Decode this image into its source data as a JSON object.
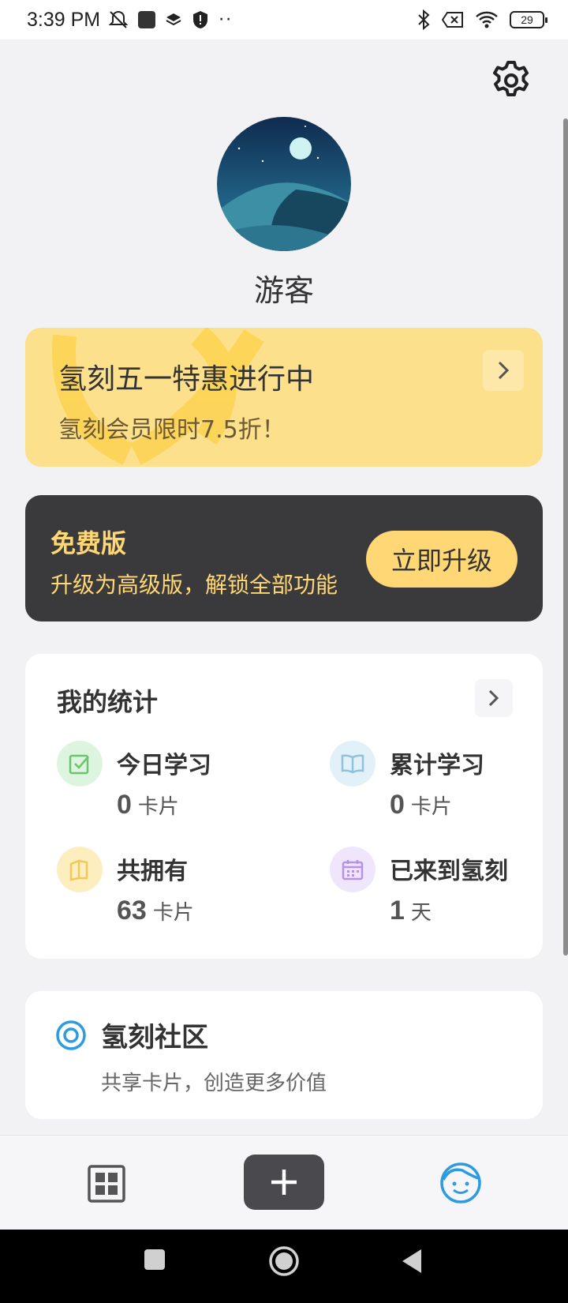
{
  "status_bar": {
    "time": "3:39 PM",
    "battery": "29",
    "icons": [
      "mute-icon",
      "app-icon",
      "layers-icon",
      "shield-icon",
      "more-dots-icon",
      "bluetooth-icon",
      "sim-off-icon",
      "wifi-icon",
      "battery-icon"
    ]
  },
  "profile": {
    "username": "游客"
  },
  "promo": {
    "title": "氢刻五一特惠进行中",
    "subtitle": "氢刻会员限时7.5折！"
  },
  "plan": {
    "name": "免费版",
    "description": "升级为高级版，解锁全部功能",
    "upgrade_label": "立即升级"
  },
  "stats": {
    "title": "我的统计",
    "items": [
      {
        "label": "今日学习",
        "value": "0",
        "unit": "卡片",
        "icon": "checkbox-icon"
      },
      {
        "label": "累计学习",
        "value": "0",
        "unit": "卡片",
        "icon": "book-icon"
      },
      {
        "label": "共拥有",
        "value": "63",
        "unit": "卡片",
        "icon": "cards-icon"
      },
      {
        "label": "已来到氢刻",
        "value": "1",
        "unit": "天",
        "icon": "calendar-icon"
      }
    ]
  },
  "community": {
    "title": "氢刻社区",
    "description": "共享卡片，创造更多价值"
  },
  "colors": {
    "promo_bg": "#fde08c",
    "upgrade_bg": "#3a3a3c",
    "accent_gold": "#ffd774",
    "accent_blue": "#2d9be0"
  }
}
